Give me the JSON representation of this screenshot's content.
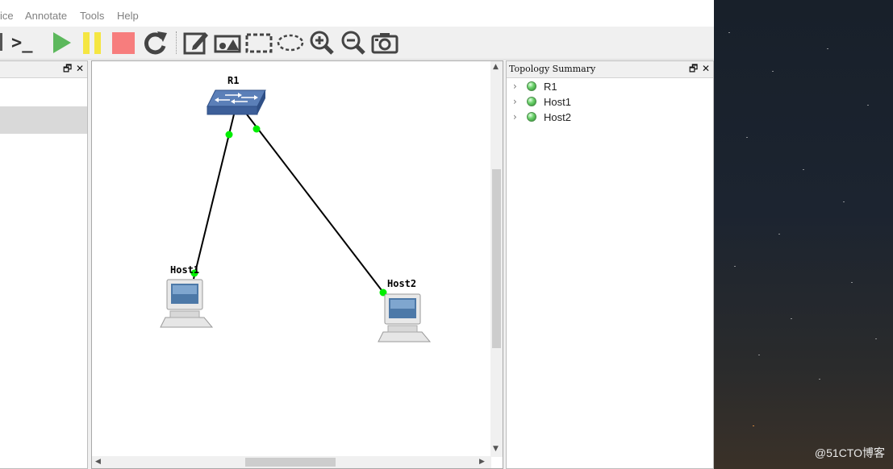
{
  "menubar": {
    "items": [
      "ice",
      "Annotate",
      "Tools",
      "Help"
    ]
  },
  "toolbar": {
    "icons": [
      "console-connect-all-icon",
      "start-all-icon",
      "suspend-all-icon",
      "stop-all-icon",
      "reload-all-icon",
      "add-note-icon",
      "insert-picture-icon",
      "draw-rectangle-icon",
      "draw-ellipse-icon",
      "zoom-in-icon",
      "zoom-out-icon",
      "screenshot-icon"
    ],
    "console_glyph": ">_"
  },
  "left_dock": {
    "float_glyph": "🗗",
    "close_glyph": "✕"
  },
  "topology": {
    "nodes": [
      {
        "label": "R1",
        "type": "switch"
      },
      {
        "label": "Host1",
        "type": "computer"
      },
      {
        "label": "Host2",
        "type": "computer"
      }
    ],
    "links": [
      {
        "from": "R1",
        "to": "Host1",
        "status": "up"
      },
      {
        "from": "R1",
        "to": "Host2",
        "status": "up"
      }
    ],
    "status_color": "#00ee00"
  },
  "topology_summary": {
    "title": "Topology Summary",
    "float_glyph": "🗗",
    "close_glyph": "✕",
    "items": [
      {
        "label": "R1",
        "status": "started"
      },
      {
        "label": "Host1",
        "status": "started"
      },
      {
        "label": "Host2",
        "status": "started"
      }
    ]
  },
  "desktop": {
    "watermark": "@51CTO博客"
  }
}
